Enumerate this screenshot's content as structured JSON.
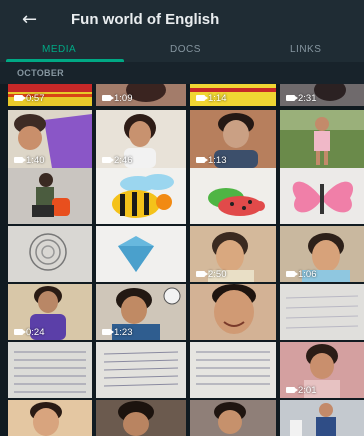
{
  "header": {
    "back_icon": "arrow-left-icon",
    "title": "Fun world of English"
  },
  "tabs": [
    {
      "label": "MEDIA",
      "active": true
    },
    {
      "label": "DOCS",
      "active": false
    },
    {
      "label": "LINKS",
      "active": false
    }
  ],
  "section_label": "OCTOBER",
  "colors": {
    "accent": "#00a884",
    "appbar": "#1f2c34"
  },
  "tiles": [
    {
      "video": true,
      "duration": "0:57"
    },
    {
      "video": true,
      "duration": "1:09"
    },
    {
      "video": true,
      "duration": "1:14"
    },
    {
      "video": true,
      "duration": "2:31"
    },
    {
      "video": true,
      "duration": "1:40"
    },
    {
      "video": true,
      "duration": "2:46"
    },
    {
      "video": true,
      "duration": "1:13"
    },
    {
      "video": false,
      "duration": ""
    },
    {
      "video": false,
      "duration": ""
    },
    {
      "video": false,
      "duration": ""
    },
    {
      "video": false,
      "duration": ""
    },
    {
      "video": false,
      "duration": ""
    },
    {
      "video": false,
      "duration": ""
    },
    {
      "video": false,
      "duration": ""
    },
    {
      "video": true,
      "duration": "2:50"
    },
    {
      "video": true,
      "duration": "1:06"
    },
    {
      "video": true,
      "duration": "0:24"
    },
    {
      "video": true,
      "duration": "1:23"
    },
    {
      "video": false,
      "duration": ""
    },
    {
      "video": false,
      "duration": ""
    },
    {
      "video": false,
      "duration": ""
    },
    {
      "video": false,
      "duration": ""
    },
    {
      "video": false,
      "duration": ""
    },
    {
      "video": true,
      "duration": "2:01"
    },
    {
      "video": false,
      "duration": ""
    },
    {
      "video": false,
      "duration": ""
    },
    {
      "video": false,
      "duration": ""
    },
    {
      "video": false,
      "duration": ""
    }
  ]
}
